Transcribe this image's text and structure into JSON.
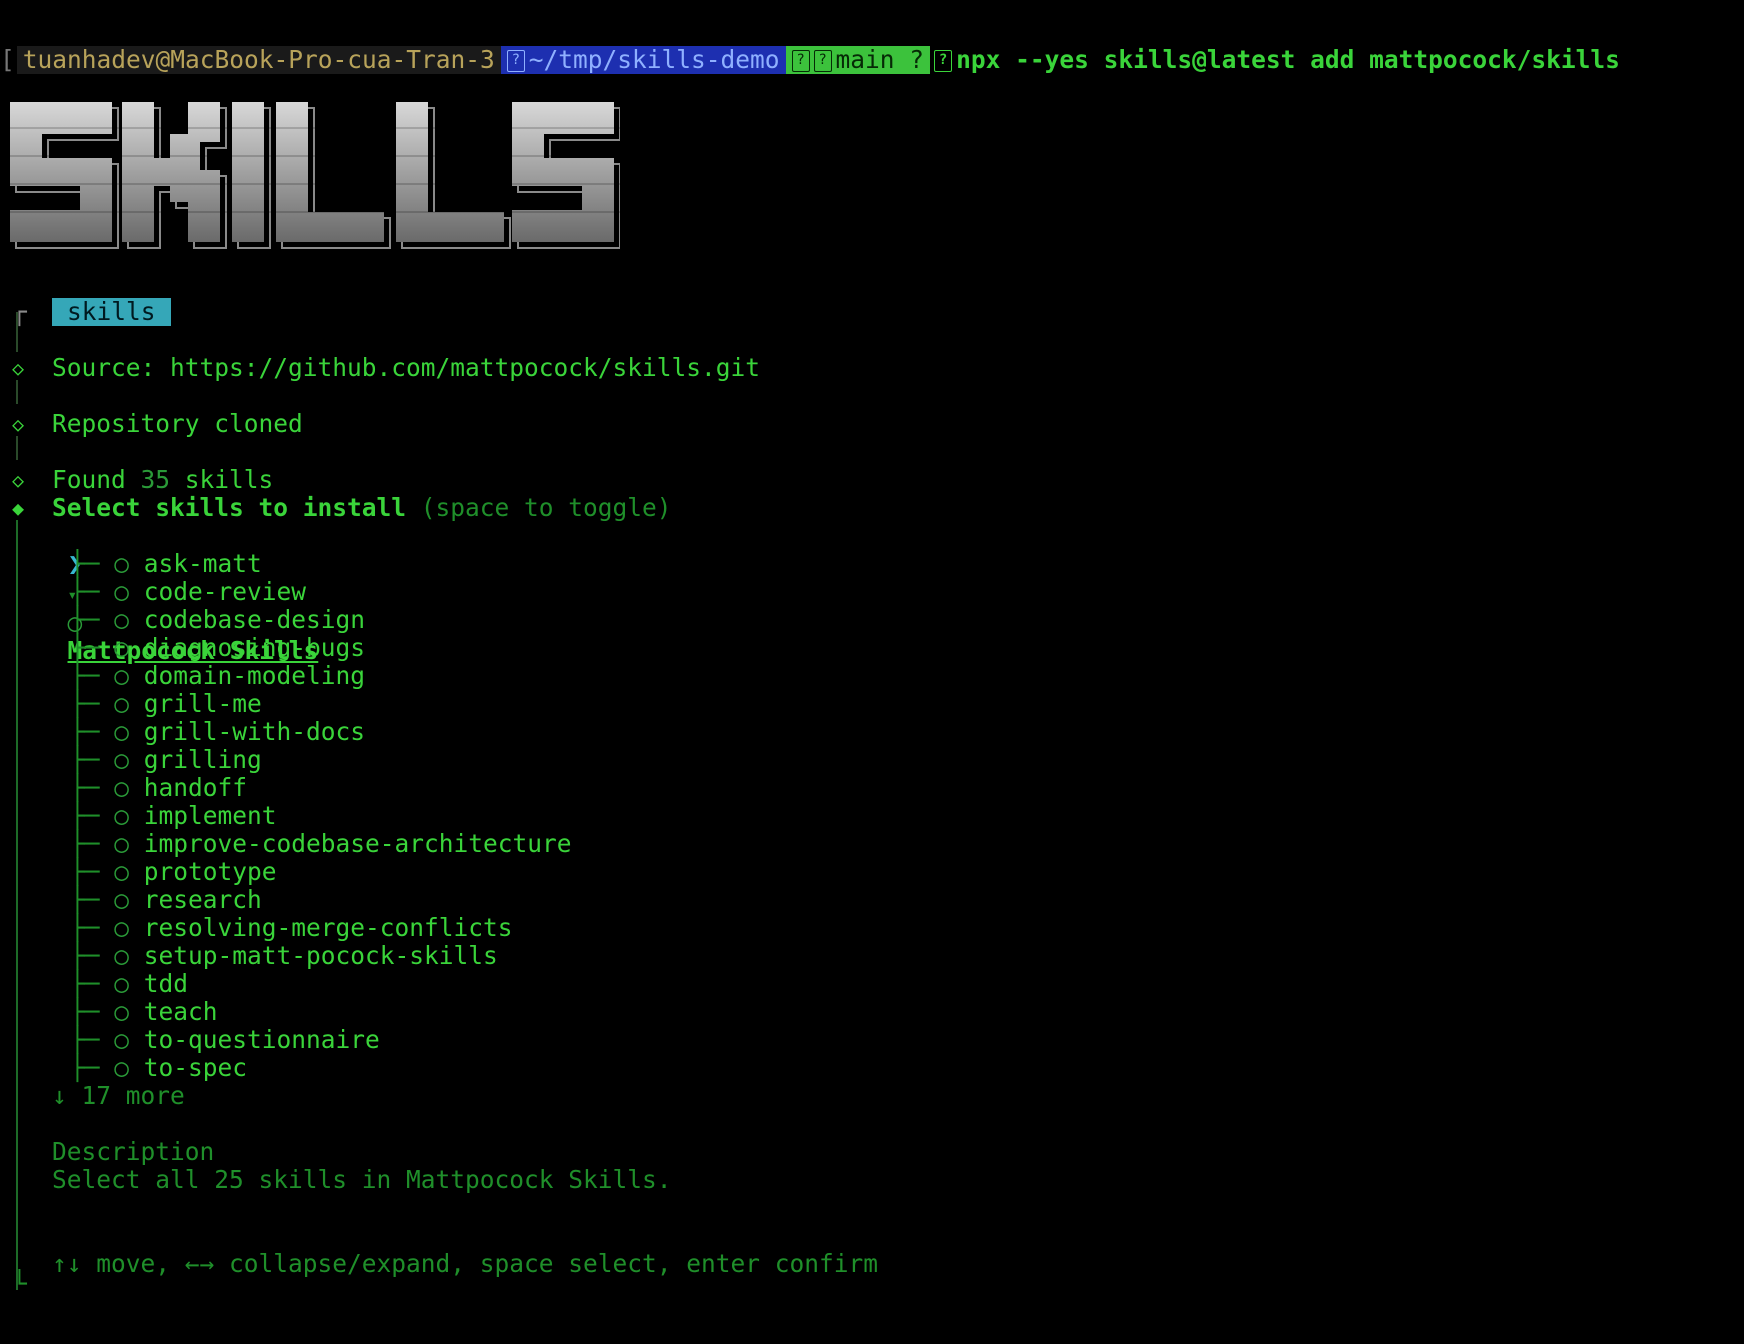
{
  "prompt": {
    "bracket": "[",
    "user_host": "tuanhadev@MacBook-Pro-cua-Tran-3",
    "path": "~/tmp/skills-demo",
    "branch": "main ?",
    "command": "npx --yes skills@latest add mattpocock/skills"
  },
  "logo_text": "SKILLS",
  "tag": "skills",
  "source_line": "Source: https://github.com/mattpocock/skills.git",
  "repo_line": "Repository cloned",
  "found_prefix": "Found ",
  "found_count": "35",
  "found_suffix": " skills",
  "select_title": "Select skills to install",
  "select_hint": "(space to toggle)",
  "group": {
    "cursor": "❯",
    "caret": "▾",
    "circle": "○",
    "name": "Mattpocock Skills"
  },
  "skills": [
    "ask-matt",
    "code-review",
    "codebase-design",
    "diagnosing-bugs",
    "domain-modeling",
    "grill-me",
    "grill-with-docs",
    "grilling",
    "handoff",
    "implement",
    "improve-codebase-architecture",
    "prototype",
    "research",
    "resolving-merge-conflicts",
    "setup-matt-pocock-skills",
    "tdd",
    "teach",
    "to-questionnaire",
    "to-spec"
  ],
  "more_line": "↓ 17 more",
  "description_label": "Description",
  "description_text": "Select all 25 skills in Mattpocock Skills.",
  "help_line": "↑↓ move, ←→ collapse/expand, space select, enter confirm"
}
